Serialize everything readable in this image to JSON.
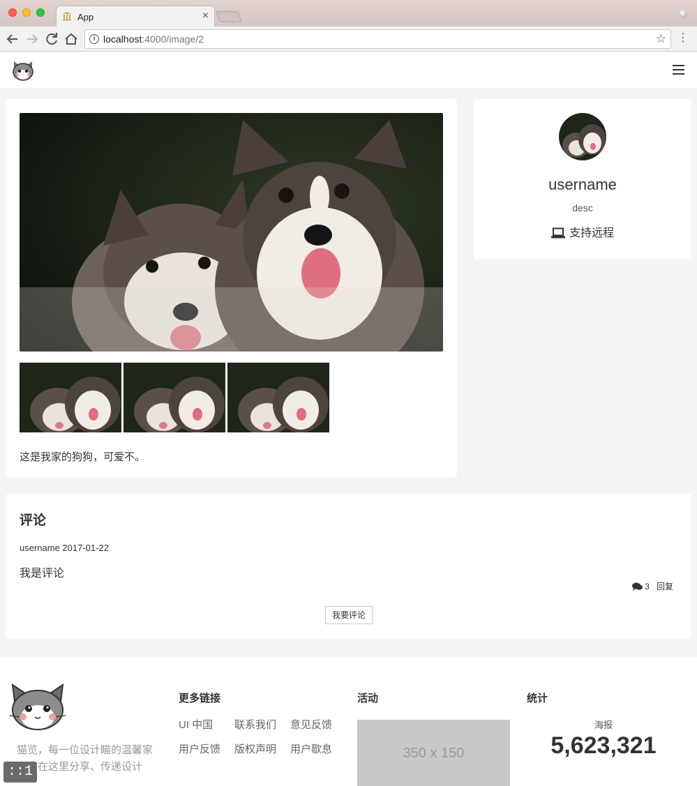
{
  "browser": {
    "tab_title": "App",
    "tab_close": "×",
    "url_host": "localhost",
    "url_path": ":4000/image/2"
  },
  "post": {
    "caption": "这是我家的狗狗，可爱不。"
  },
  "profile": {
    "name": "username",
    "desc": "desc",
    "remote_label": "支持远程"
  },
  "comments": {
    "title": "评论",
    "items": [
      {
        "author_date": "username 2017-01-22",
        "body": "我是评论",
        "count": "3",
        "reply_label": "回复"
      }
    ],
    "add_button": "我要评论"
  },
  "footer": {
    "tagline": "猫览，每一位设计瞄的温馨家园，在这里分享、传递设计",
    "links_title": "更多链接",
    "links": [
      "UI 中国",
      "联系我们",
      "意见反馈",
      "用户反馈",
      "版权声明",
      "用户歇息"
    ],
    "activity_title": "活动",
    "ad_placeholder": "350 x 150",
    "stats_title": "统计",
    "stat_label": "海报",
    "stat_value": "5,623,321"
  },
  "status_pill": "::1"
}
